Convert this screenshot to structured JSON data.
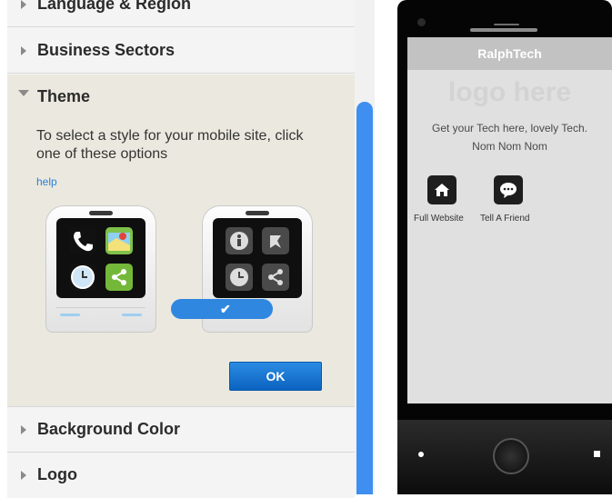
{
  "panel": {
    "sections": {
      "language": "Language & Region",
      "business": "Business Sectors",
      "theme": "Theme",
      "background": "Background Color",
      "logo": "Logo"
    },
    "theme": {
      "description": "To select a style for your mobile site, click one of these options",
      "help": "help",
      "ok": "OK",
      "check": "✔"
    }
  },
  "preview": {
    "site_name": "RalphTech",
    "logo_placeholder": "logo here",
    "tagline": "Get your Tech here, lovely Tech. Nom Nom Nom",
    "buttons": [
      {
        "label": "Full Website",
        "icon": "home-icon"
      },
      {
        "label": "Tell A Friend",
        "icon": "chat-bubble-icon"
      }
    ]
  },
  "colors": {
    "accent": "#2f87e0",
    "ok_button": "#1572d3",
    "theme_bg": "#ebe9df"
  }
}
